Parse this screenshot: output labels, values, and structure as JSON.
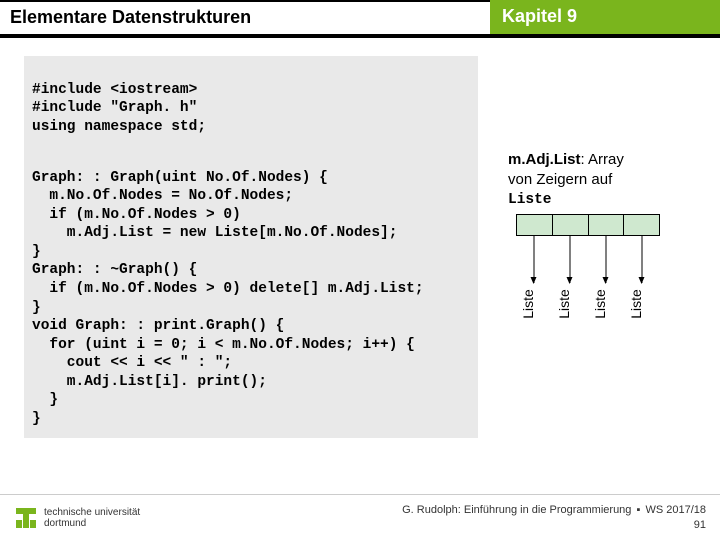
{
  "header": {
    "left": "Elementare Datenstrukturen",
    "right": "Kapitel 9"
  },
  "code": {
    "l1": "#include <iostream>",
    "l2": "#include \"Graph. h\"",
    "l3": "using namespace std;",
    "l4": "Graph: : Graph(uint No.Of.Nodes) {",
    "l5": "  m.No.Of.Nodes = No.Of.Nodes;",
    "l6": "  if (m.No.Of.Nodes > 0)",
    "l7": "    m.Adj.List = new Liste[m.No.Of.Nodes];",
    "l8": "}",
    "l9": "Graph: : ~Graph() {",
    "l10": "  if (m.No.Of.Nodes > 0) delete[] m.Adj.List;",
    "l11": "}",
    "l12": "void Graph: : print.Graph() {",
    "l13": "  for (uint i = 0; i < m.No.Of.Nodes; i++) {",
    "l14": "    cout << i << \" : \";",
    "l15": "    m.Adj.List[i]. print();",
    "l16": "  }",
    "l17": "}"
  },
  "annotation": {
    "bold1": "m.Adj.List",
    "text1": ": Array",
    "text2": "von Zeigern auf",
    "mono": "Liste"
  },
  "diagram": {
    "cells": 4,
    "vlabel": "Liste"
  },
  "footer": {
    "uni1": "technische universität",
    "uni2": "dortmund",
    "author": "G. Rudolph: Einführung in die Programmierung",
    "sep": "▪",
    "term": "WS 2017/18",
    "page": "91"
  }
}
